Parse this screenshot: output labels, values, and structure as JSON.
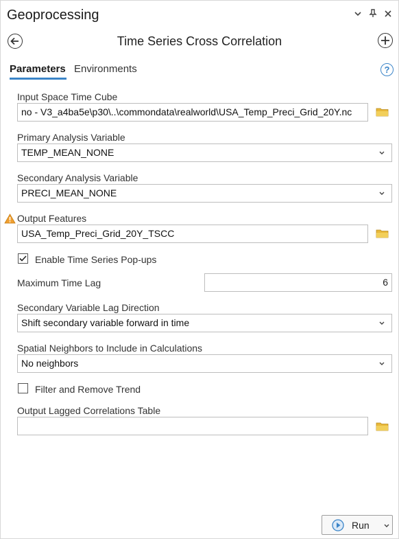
{
  "pane": {
    "title": "Geoprocessing",
    "header_controls": [
      "chevron-down-icon",
      "pin-icon",
      "close-icon"
    ]
  },
  "tool": {
    "title": "Time Series Cross Correlation"
  },
  "tabs": [
    {
      "label": "Parameters",
      "active": true
    },
    {
      "label": "Environments",
      "active": false
    }
  ],
  "params": {
    "input_cube": {
      "label": "Input Space Time Cube",
      "value": "no - V3_a4ba5e\\p30\\..\\commondata\\realworld\\USA_Temp_Preci_Grid_20Y.nc"
    },
    "primary_var": {
      "label": "Primary Analysis Variable",
      "value": "TEMP_MEAN_NONE"
    },
    "secondary_var": {
      "label": "Secondary Analysis Variable",
      "value": "PRECI_MEAN_NONE"
    },
    "output_features": {
      "label": "Output Features",
      "value": "USA_Temp_Preci_Grid_20Y_TSCC",
      "warning": true
    },
    "popups": {
      "label": "Enable Time Series Pop-ups",
      "checked": true
    },
    "max_lag": {
      "label": "Maximum Time Lag",
      "value": "6"
    },
    "lag_direction": {
      "label": "Secondary Variable Lag Direction",
      "value": "Shift secondary variable forward in time"
    },
    "neighbors": {
      "label": "Spatial Neighbors to Include in Calculations",
      "value": "No neighbors"
    },
    "trend": {
      "label": "Filter and Remove Trend",
      "checked": false
    },
    "lag_table": {
      "label": "Output Lagged Correlations Table",
      "value": ""
    }
  },
  "run": {
    "label": "Run"
  },
  "colors": {
    "accent": "#3a84c8",
    "folder": "#e8b83a",
    "warning": "#f0a030"
  }
}
